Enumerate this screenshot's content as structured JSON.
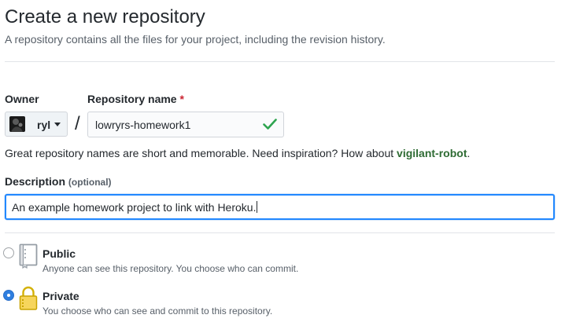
{
  "header": {
    "title": "Create a new repository",
    "subtitle": "A repository contains all the files for your project, including the revision history."
  },
  "owner": {
    "label": "Owner",
    "name": "ryl"
  },
  "repository": {
    "label": "Repository name",
    "required_mark": "*",
    "separator": "/",
    "value": "lowryrs-homework1"
  },
  "hint": {
    "text": "Great repository names are short and memorable. Need inspiration? How about ",
    "suggestion": "vigilant-robot",
    "end": "."
  },
  "description": {
    "label": "Description",
    "optional": "(optional)",
    "value": "An example homework project to link with Heroku."
  },
  "visibility": {
    "selected": "private",
    "public": {
      "title": "Public",
      "desc": "Anyone can see this repository. You choose who can commit.",
      "icon": "repo-book-icon"
    },
    "private": {
      "title": "Private",
      "desc": "You choose who can see and commit to this repository.",
      "icon": "lock-icon"
    }
  },
  "colors": {
    "valid_check": "#2ea44f",
    "focus_border": "#2188ff",
    "required": "#cb2431",
    "radio_selected": "#2f7fe0"
  }
}
